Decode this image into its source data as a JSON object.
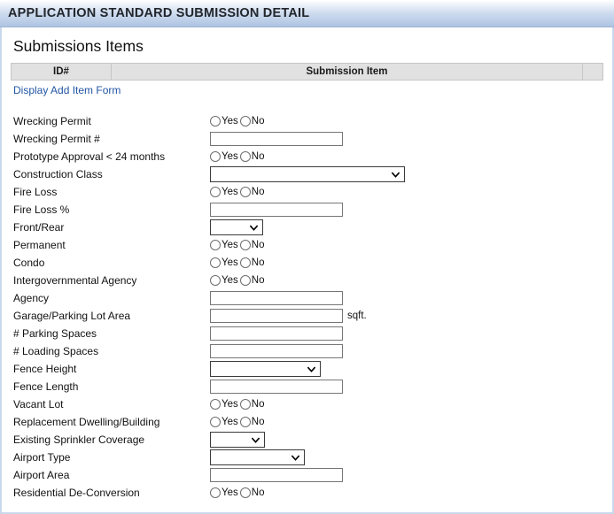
{
  "window": {
    "title": "APPLICATION STANDARD SUBMISSION DETAIL"
  },
  "section": {
    "heading": "Submissions Items"
  },
  "items_table": {
    "columns": [
      "ID#",
      "Submission Item",
      ""
    ],
    "add_link": "Display Add Item Form",
    "rows": []
  },
  "radio": {
    "yes": "Yes",
    "no": "No"
  },
  "form": {
    "rows": [
      {
        "label": "Wrecking Permit",
        "type": "radio"
      },
      {
        "label": "Wrecking Permit #",
        "type": "text",
        "value": "",
        "width": "w150"
      },
      {
        "label": "Prototype Approval < 24 months",
        "type": "radio"
      },
      {
        "label": "Construction Class",
        "type": "select",
        "value": "",
        "width": "sel-w220"
      },
      {
        "label": "Fire Loss",
        "type": "radio"
      },
      {
        "label": "Fire Loss %",
        "type": "text",
        "value": "",
        "width": "w150"
      },
      {
        "label": "Front/Rear",
        "type": "select",
        "value": "",
        "width": "sel-w60"
      },
      {
        "label": "Permanent",
        "type": "radio"
      },
      {
        "label": "Condo",
        "type": "radio"
      },
      {
        "label": "Intergovernmental Agency",
        "type": "radio"
      },
      {
        "label": "Agency",
        "type": "text",
        "value": "",
        "width": "w150"
      },
      {
        "label": "Garage/Parking Lot Area",
        "type": "text",
        "value": "",
        "width": "w150",
        "suffix": "sqft."
      },
      {
        "label": "# Parking Spaces",
        "type": "text",
        "value": "",
        "width": "w150"
      },
      {
        "label": "# Loading Spaces",
        "type": "text",
        "value": "",
        "width": "w150"
      },
      {
        "label": "Fence Height",
        "type": "select",
        "value": "",
        "width": "sel-w125"
      },
      {
        "label": "Fence Length",
        "type": "text",
        "value": "",
        "width": "w150"
      },
      {
        "label": "Vacant Lot",
        "type": "radio"
      },
      {
        "label": "Replacement Dwelling/Building",
        "type": "radio"
      },
      {
        "label": "Existing Sprinkler Coverage",
        "type": "select",
        "value": "",
        "width": "sel-w62"
      },
      {
        "label": "Airport Type",
        "type": "select",
        "value": "",
        "width": "sel-w107"
      },
      {
        "label": "Airport Area",
        "type": "text",
        "value": "",
        "width": "w150"
      },
      {
        "label": "Residential De-Conversion",
        "type": "radio"
      }
    ]
  },
  "colors": {
    "titlebar_gradient_top": "#ffffff",
    "titlebar_gradient_bottom": "#aec4e2",
    "panel_border": "#c9d9ec",
    "table_header_bg": "#e1e1e1",
    "link": "#2255a4"
  }
}
